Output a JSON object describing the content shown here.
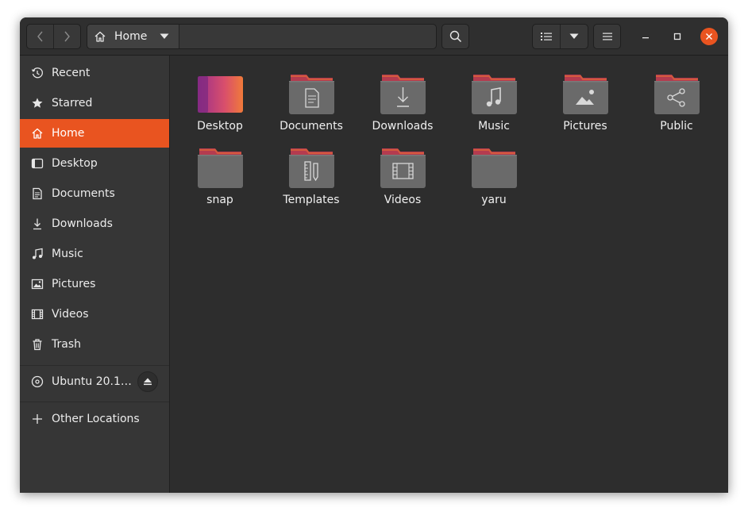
{
  "headerbar": {
    "back_icon": "chevron-left-icon",
    "forward_icon": "chevron-right-icon",
    "path_label": "Home",
    "path_icon": "home-icon",
    "search_icon": "search-icon",
    "view_icon": "list-view-icon",
    "view_menu_icon": "chevron-down-icon",
    "menu_icon": "hamburger-menu-icon"
  },
  "window_controls": {
    "minimize_icon": "minimize-icon",
    "maximize_icon": "maximize-icon",
    "close_icon": "close-icon",
    "close_color": "#e95420"
  },
  "sidebar": {
    "items": [
      {
        "label": "Recent",
        "icon": "clock-icon"
      },
      {
        "label": "Starred",
        "icon": "star-icon"
      },
      {
        "label": "Home",
        "icon": "home-icon",
        "active": true
      },
      {
        "label": "Desktop",
        "icon": "desktop-icon"
      },
      {
        "label": "Documents",
        "icon": "document-icon"
      },
      {
        "label": "Downloads",
        "icon": "download-icon"
      },
      {
        "label": "Music",
        "icon": "music-icon"
      },
      {
        "label": "Pictures",
        "icon": "picture-icon"
      },
      {
        "label": "Videos",
        "icon": "film-icon"
      },
      {
        "label": "Trash",
        "icon": "trash-icon"
      }
    ],
    "devices": [
      {
        "label": "Ubuntu 20.1…",
        "icon": "disc-icon",
        "action_icon": "eject-icon"
      }
    ],
    "other": {
      "label": "Other Locations",
      "icon": "plus-icon"
    }
  },
  "files": [
    {
      "name": "Desktop",
      "icon": "desktop-folder-icon"
    },
    {
      "name": "Documents",
      "icon": "documents-folder-icon"
    },
    {
      "name": "Downloads",
      "icon": "downloads-folder-icon"
    },
    {
      "name": "Music",
      "icon": "music-folder-icon"
    },
    {
      "name": "Pictures",
      "icon": "pictures-folder-icon"
    },
    {
      "name": "Public",
      "icon": "public-folder-icon"
    },
    {
      "name": "snap",
      "icon": "folder-icon"
    },
    {
      "name": "Templates",
      "icon": "templates-folder-icon"
    },
    {
      "name": "Videos",
      "icon": "videos-folder-icon"
    },
    {
      "name": "yaru",
      "icon": "folder-icon"
    }
  ],
  "colors": {
    "accent": "#e95420",
    "window_bg": "#2d2d2d",
    "sidebar_bg": "#363636",
    "folder_body": "#6a6a6a",
    "folder_tab": "#b43b4f"
  }
}
